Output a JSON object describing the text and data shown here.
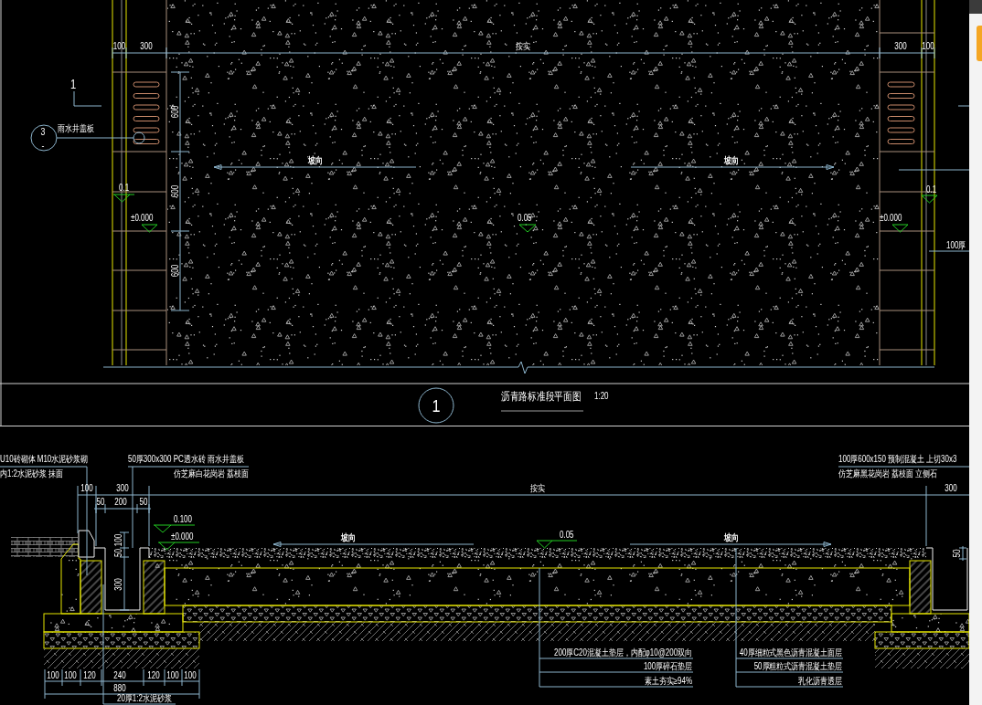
{
  "plan_view": {
    "top_dimensions": [
      "100",
      "300",
      "按实",
      "300",
      "100"
    ],
    "section_mark": "1",
    "detail_callout": {
      "number": "3",
      "sheet": "-",
      "label": "雨水井盖板"
    },
    "side_dimensions": [
      "600",
      "600",
      "600"
    ],
    "slope_labels": [
      "坡向",
      "坡向"
    ],
    "elevations": [
      "0.1",
      "±0.000",
      "0.05",
      "±0.000",
      "0.1"
    ],
    "side_note": "100厚",
    "title": {
      "number": "1",
      "name": "沥青路标准段平面图",
      "scale": "1:20"
    }
  },
  "section_view": {
    "notes": [
      {
        "lines": [
          "U10砖砌体 M10水泥砂浆砌",
          "内1:2水泥砂浆 抹面"
        ]
      },
      {
        "lines": [
          "50厚300x300 PC透水砖 雨水井盖板",
          "仿芝麻白花岗岩 荔枝面"
        ]
      },
      {
        "lines": [
          "100厚600x150 预制混凝土 上切30x3",
          "仿芝麻黑花岗岩 荔枝面 立侧石"
        ]
      }
    ],
    "top_dimensions": [
      "100",
      "300",
      "按实",
      "300"
    ],
    "gutter_dimensions": [
      "50",
      "200",
      "50"
    ],
    "elevations": [
      "0.100",
      "±0.000",
      "0.05"
    ],
    "slope_labels": [
      "坡向",
      "坡向"
    ],
    "depth_dimensions": [
      "50",
      "100",
      "300"
    ],
    "edge_dimension": "50",
    "bottom_dimensions": [
      "100",
      "100",
      "120",
      "240",
      "120",
      "100",
      "100"
    ],
    "total_dimension": "880",
    "bottom_note": "20厚1:2水泥砂浆",
    "layer_notes": [
      {
        "lines": [
          "200厚C20混凝土垫层，内配φ10@200双向",
          "100厚碎石垫层",
          "素土夯实≥94%"
        ]
      },
      {
        "lines": [
          "40厚细粒式黑色沥青混凝土面层",
          "50厚粗粒式沥青混凝土垫层",
          "乳化沥青透层"
        ]
      }
    ]
  }
}
